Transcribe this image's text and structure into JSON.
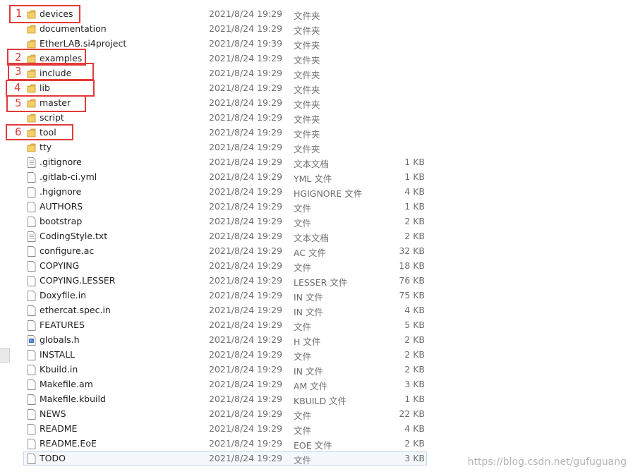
{
  "files": [
    {
      "name": "devices",
      "date": "2021/8/24 19:29",
      "type": "文件夹",
      "size": "",
      "icon": "folder-icon"
    },
    {
      "name": "documentation",
      "date": "2021/8/24 19:29",
      "type": "文件夹",
      "size": "",
      "icon": "folder-icon"
    },
    {
      "name": "EtherLAB.si4project",
      "date": "2021/8/24 19:39",
      "type": "文件夹",
      "size": "",
      "icon": "folder-icon"
    },
    {
      "name": "examples",
      "date": "2021/8/24 19:29",
      "type": "文件夹",
      "size": "",
      "icon": "folder-icon"
    },
    {
      "name": "include",
      "date": "2021/8/24 19:29",
      "type": "文件夹",
      "size": "",
      "icon": "folder-icon"
    },
    {
      "name": "lib",
      "date": "2021/8/24 19:29",
      "type": "文件夹",
      "size": "",
      "icon": "folder-icon"
    },
    {
      "name": "master",
      "date": "2021/8/24 19:29",
      "type": "文件夹",
      "size": "",
      "icon": "folder-icon"
    },
    {
      "name": "script",
      "date": "2021/8/24 19:29",
      "type": "文件夹",
      "size": "",
      "icon": "folder-icon"
    },
    {
      "name": "tool",
      "date": "2021/8/24 19:29",
      "type": "文件夹",
      "size": "",
      "icon": "folder-icon"
    },
    {
      "name": "tty",
      "date": "2021/8/24 19:29",
      "type": "文件夹",
      "size": "",
      "icon": "folder-icon"
    },
    {
      "name": ".gitignore",
      "date": "2021/8/24 19:29",
      "type": "文本文档",
      "size": "1 KB",
      "icon": "text-file-icon"
    },
    {
      "name": ".gitlab-ci.yml",
      "date": "2021/8/24 19:29",
      "type": "YML 文件",
      "size": "1 KB",
      "icon": "file-icon"
    },
    {
      "name": ".hgignore",
      "date": "2021/8/24 19:29",
      "type": "HGIGNORE 文件",
      "size": "4 KB",
      "icon": "file-icon"
    },
    {
      "name": "AUTHORS",
      "date": "2021/8/24 19:29",
      "type": "文件",
      "size": "1 KB",
      "icon": "file-icon"
    },
    {
      "name": "bootstrap",
      "date": "2021/8/24 19:29",
      "type": "文件",
      "size": "2 KB",
      "icon": "file-icon"
    },
    {
      "name": "CodingStyle.txt",
      "date": "2021/8/24 19:29",
      "type": "文本文档",
      "size": "2 KB",
      "icon": "text-file-icon"
    },
    {
      "name": "configure.ac",
      "date": "2021/8/24 19:29",
      "type": "AC 文件",
      "size": "32 KB",
      "icon": "file-icon"
    },
    {
      "name": "COPYING",
      "date": "2021/8/24 19:29",
      "type": "文件",
      "size": "18 KB",
      "icon": "file-icon"
    },
    {
      "name": "COPYING.LESSER",
      "date": "2021/8/24 19:29",
      "type": "LESSER 文件",
      "size": "76 KB",
      "icon": "file-icon"
    },
    {
      "name": "Doxyfile.in",
      "date": "2021/8/24 19:29",
      "type": "IN 文件",
      "size": "75 KB",
      "icon": "file-icon"
    },
    {
      "name": "ethercat.spec.in",
      "date": "2021/8/24 19:29",
      "type": "IN 文件",
      "size": "4 KB",
      "icon": "file-icon"
    },
    {
      "name": "FEATURES",
      "date": "2021/8/24 19:29",
      "type": "文件",
      "size": "5 KB",
      "icon": "file-icon"
    },
    {
      "name": "globals.h",
      "date": "2021/8/24 19:29",
      "type": "H 文件",
      "size": "2 KB",
      "icon": "header-file-icon"
    },
    {
      "name": "INSTALL",
      "date": "2021/8/24 19:29",
      "type": "文件",
      "size": "2 KB",
      "icon": "file-icon"
    },
    {
      "name": "Kbuild.in",
      "date": "2021/8/24 19:29",
      "type": "IN 文件",
      "size": "2 KB",
      "icon": "file-icon"
    },
    {
      "name": "Makefile.am",
      "date": "2021/8/24 19:29",
      "type": "AM 文件",
      "size": "3 KB",
      "icon": "file-icon"
    },
    {
      "name": "Makefile.kbuild",
      "date": "2021/8/24 19:29",
      "type": "KBUILD 文件",
      "size": "1 KB",
      "icon": "file-icon"
    },
    {
      "name": "NEWS",
      "date": "2021/8/24 19:29",
      "type": "文件",
      "size": "22 KB",
      "icon": "file-icon"
    },
    {
      "name": "README",
      "date": "2021/8/24 19:29",
      "type": "文件",
      "size": "4 KB",
      "icon": "file-icon"
    },
    {
      "name": "README.EoE",
      "date": "2021/8/24 19:29",
      "type": "EOE 文件",
      "size": "2 KB",
      "icon": "file-icon"
    },
    {
      "name": "TODO",
      "date": "2021/8/24 19:29",
      "type": "文件",
      "size": "3 KB",
      "icon": "file-icon",
      "selected": true
    }
  ],
  "annotations": [
    {
      "number": "1",
      "row": 0
    },
    {
      "number": "2",
      "row": 3
    },
    {
      "number": "3",
      "row": 4
    },
    {
      "number": "4",
      "row": 5
    },
    {
      "number": "5",
      "row": 6
    },
    {
      "number": "6",
      "row": 8
    }
  ],
  "watermark": "https://blog.csdn.net/gufuguang",
  "colors": {
    "annotation": "#e23a3a",
    "folder": "#e8b84a",
    "selection": "#c9d7ea"
  }
}
